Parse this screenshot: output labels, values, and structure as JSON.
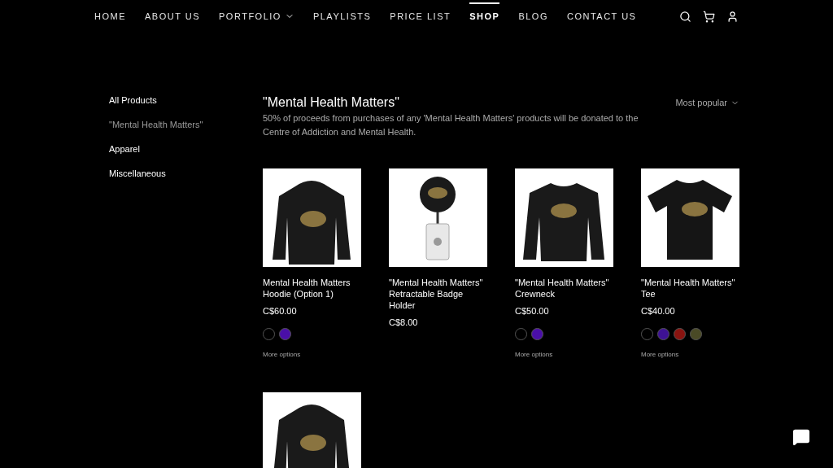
{
  "nav": {
    "items": [
      {
        "label": "HOME",
        "selected": false,
        "dropdown": false
      },
      {
        "label": "ABOUT US",
        "selected": false,
        "dropdown": false
      },
      {
        "label": "PORTFOLIO",
        "selected": false,
        "dropdown": true
      },
      {
        "label": "PLAYLISTS",
        "selected": false,
        "dropdown": false
      },
      {
        "label": "PRICE LIST",
        "selected": false,
        "dropdown": false
      },
      {
        "label": "SHOP",
        "selected": true,
        "dropdown": false
      },
      {
        "label": "BLOG",
        "selected": false,
        "dropdown": false
      },
      {
        "label": "CONTACT US",
        "selected": false,
        "dropdown": false
      }
    ]
  },
  "sidebar": {
    "items": [
      {
        "label": "All Products",
        "selected": false
      },
      {
        "label": "\"Mental Health Matters\"",
        "selected": true
      },
      {
        "label": "Apparel",
        "selected": false
      },
      {
        "label": "Miscellaneous",
        "selected": false
      }
    ]
  },
  "category": {
    "title": "\"Mental Health Matters\"",
    "description": "50% of proceeds from purchases of any 'Mental Health Matters' products will be donated to the Centre of Addiction and Mental Health.",
    "sort": "Most popular"
  },
  "products": [
    {
      "kind": "hoodie",
      "name": "Mental Health Matters Hoodie (Option 1)",
      "price": "C$60.00",
      "swatches": [
        {
          "color": "#000000"
        },
        {
          "color": "#4a0fa8"
        }
      ],
      "more": "More options"
    },
    {
      "kind": "badge",
      "name": "\"Mental Health Matters\" Retractable Badge Holder",
      "price": "C$8.00"
    },
    {
      "kind": "sweater",
      "name": "\"Mental Health Matters\" Crewneck",
      "price": "C$50.00",
      "swatches": [
        {
          "color": "#000000"
        },
        {
          "color": "#4a0fa8"
        }
      ],
      "more": "More options"
    },
    {
      "kind": "tee",
      "name": "\"Mental Health Matters\" Tee",
      "price": "C$40.00",
      "swatches": [
        {
          "color": "#000000"
        },
        {
          "color": "#3e1294"
        },
        {
          "color": "#8a1410"
        },
        {
          "color": "#4a4a26"
        }
      ],
      "more": "More options"
    },
    {
      "kind": "hoodie"
    }
  ]
}
